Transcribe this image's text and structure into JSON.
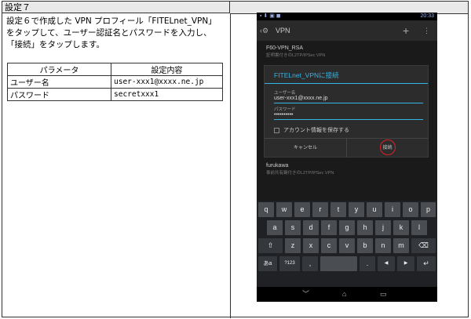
{
  "header": {
    "title": "設定７"
  },
  "instruction": {
    "line1": "設定６で作成した VPN プロフィール「FITELnet_VPN」",
    "line2": "をタップして、ユーザー認証名とパスワードを入力し、",
    "line3": "「接続」をタップします。"
  },
  "param_table": {
    "headers": [
      "パラメータ",
      "設定内容"
    ],
    "rows": [
      [
        "ユーザー名",
        "user-xxx1@xxxx.ne.jp"
      ],
      [
        "パスワード",
        "secretxxx1"
      ]
    ]
  },
  "phone": {
    "status_time": "20:33",
    "appbar_title": "VPN",
    "vpn1_name": "F60-VPN_RSA",
    "vpn1_sub": "証明書付きのL2TP/IPSec VPN",
    "vpn2_name": "furukawa",
    "vpn2_sub": "事前共有鍵付きのL2TP/IPSec VPN",
    "dialog": {
      "title": "FITELnet_VPNに接続",
      "user_label": "ユーザー名",
      "user_value": "user-xxx1@xxxx.ne.jp",
      "pass_label": "パスワード",
      "pass_value": "••••••••••",
      "save_label": "アカウント情報を保存する",
      "cancel": "キャンセル",
      "connect": "接続"
    },
    "keyboard": {
      "row1": [
        "q",
        "w",
        "e",
        "r",
        "t",
        "y",
        "u",
        "i",
        "o",
        "p"
      ],
      "row2": [
        "a",
        "s",
        "d",
        "f",
        "g",
        "h",
        "j",
        "k",
        "l"
      ],
      "row3": [
        "z",
        "x",
        "c",
        "v",
        "b",
        "n",
        "m"
      ],
      "shift": "⇧",
      "backspace": "⌫",
      "lang": "あa",
      "num": "?123",
      "comma": ",",
      "period": ".",
      "left": "◀",
      "right": "▶",
      "enter": "↵"
    },
    "nav": {
      "back": "﹀",
      "home": "⌂",
      "recent": "▭"
    }
  }
}
